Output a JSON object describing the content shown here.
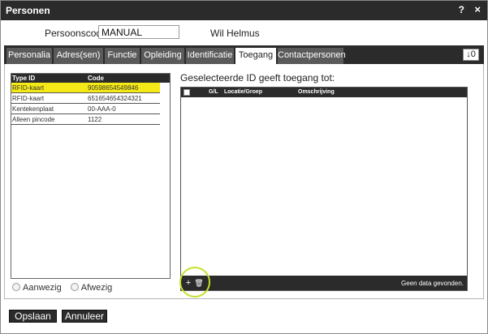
{
  "window": {
    "title": "Personen",
    "help": "?",
    "close": "×"
  },
  "person": {
    "code_label": "Persoonscode:",
    "code_value": "MANUAL",
    "name": "Wil Helmus"
  },
  "tabs": [
    "Personalia",
    "Adres(sen)",
    "Functie",
    "Opleiding",
    "Identificatie",
    "Toegang",
    "Contactpersonen"
  ],
  "active_tab": "Toegang",
  "badge": "↓0",
  "id_table": {
    "headers": {
      "type": "Type ID",
      "code": "Code"
    },
    "rows": [
      {
        "type": "RFID-kaart",
        "code": "90598654549846",
        "selected": true
      },
      {
        "type": "RFID-kaart",
        "code": "651654654324321",
        "selected": false
      },
      {
        "type": "Kentekenplaat",
        "code": "00-AAA-0",
        "selected": false
      },
      {
        "type": "Alleen pincode",
        "code": "1122",
        "selected": false
      }
    ]
  },
  "presence": {
    "present": "Aanwezig",
    "absent": "Afwezig"
  },
  "access": {
    "title": "Geselecteerde ID geeft toegang tot:",
    "headers": {
      "gl": "G/L",
      "location": "Locatie/Groep",
      "description": "Omschrijving"
    },
    "add": "+",
    "delete": "🗑",
    "empty": "Geen data gevonden."
  },
  "buttons": {
    "save": "Opslaan",
    "cancel": "Annuleer"
  },
  "colors": {
    "selected_row": "#f5ea17",
    "dark": "#2b2b2b",
    "highlight_circle": "#c8e02a"
  }
}
